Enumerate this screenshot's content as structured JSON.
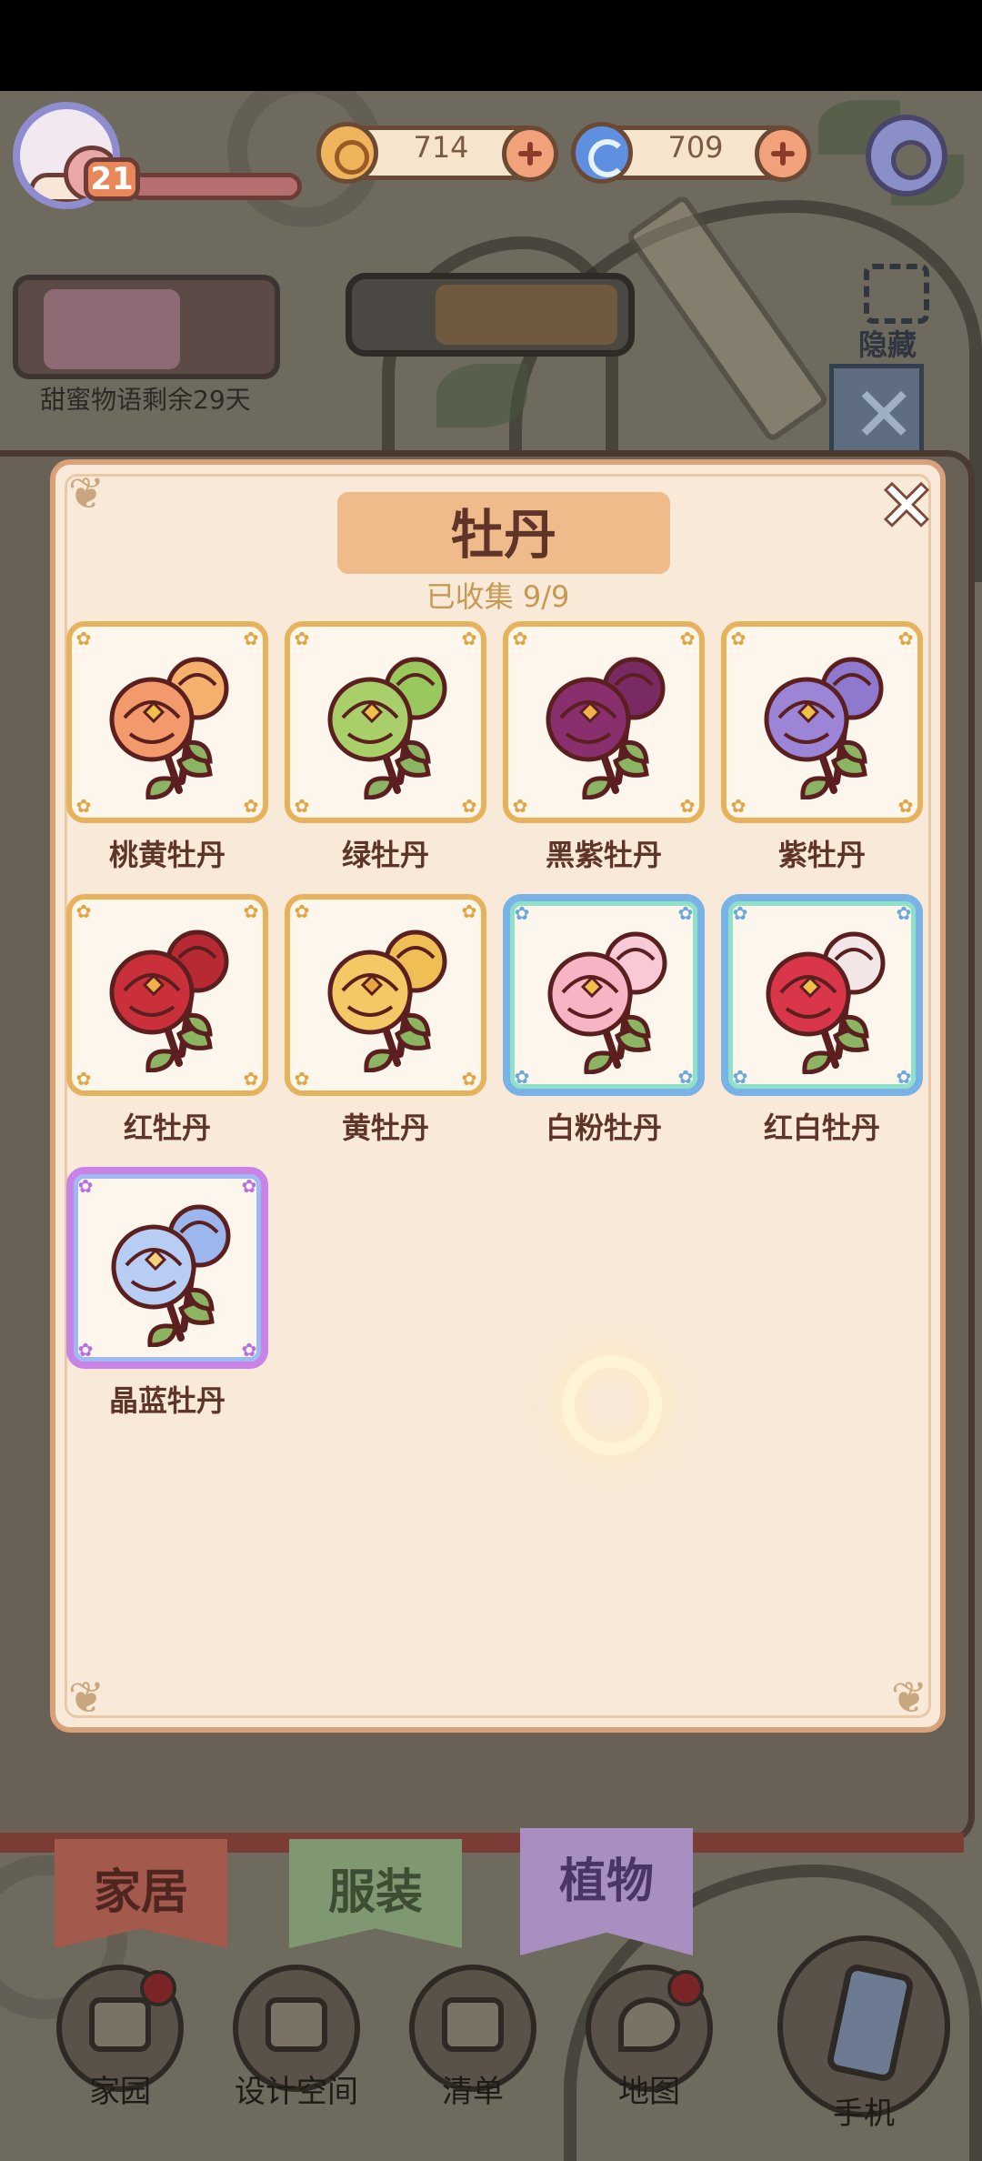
{
  "hud": {
    "level": "21",
    "coins": "714",
    "gems": "709",
    "event_label": "甜蜜物语剩余29天",
    "hide_label": "隐藏"
  },
  "modal": {
    "title": "牡丹",
    "collected": "已收集  9/9",
    "items": [
      {
        "name": "桃黄牡丹",
        "frame": "gold",
        "petal": "#f29a6c",
        "petal2": "#f5b06e",
        "center": "#f0c04a"
      },
      {
        "name": "绿牡丹",
        "frame": "gold",
        "petal": "#a9cf6a",
        "petal2": "#98c85e",
        "center": "#f0c04a"
      },
      {
        "name": "黑紫牡丹",
        "frame": "gold",
        "petal": "#8a2f6e",
        "petal2": "#7a2a62",
        "center": "#f0b04a"
      },
      {
        "name": "紫牡丹",
        "frame": "gold",
        "petal": "#9c84d6",
        "petal2": "#8f79cf",
        "center": "#f0c04a"
      },
      {
        "name": "红牡丹",
        "frame": "gold",
        "petal": "#c9303a",
        "petal2": "#b82a33",
        "center": "#f0b04a"
      },
      {
        "name": "黄牡丹",
        "frame": "gold",
        "petal": "#f3c865",
        "petal2": "#efbe55",
        "center": "#e8a540"
      },
      {
        "name": "白粉牡丹",
        "frame": "blue",
        "petal": "#f6b4c4",
        "petal2": "#f9cad5",
        "center": "#f0c04a"
      },
      {
        "name": "红白牡丹",
        "frame": "blue",
        "petal": "#d9364a",
        "petal2": "#f3e6e6",
        "center": "#f0c04a"
      },
      {
        "name": "晶蓝牡丹",
        "frame": "purple",
        "petal": "#b8cdf3",
        "petal2": "#9cb6ee",
        "center": "#f3d27a"
      }
    ]
  },
  "tabs": {
    "home": "家居",
    "clothing": "服装",
    "plants": "植物"
  },
  "nav": {
    "garden": "家园",
    "design": "设计空间",
    "list": "清单",
    "map": "地图",
    "phone": "手机"
  }
}
